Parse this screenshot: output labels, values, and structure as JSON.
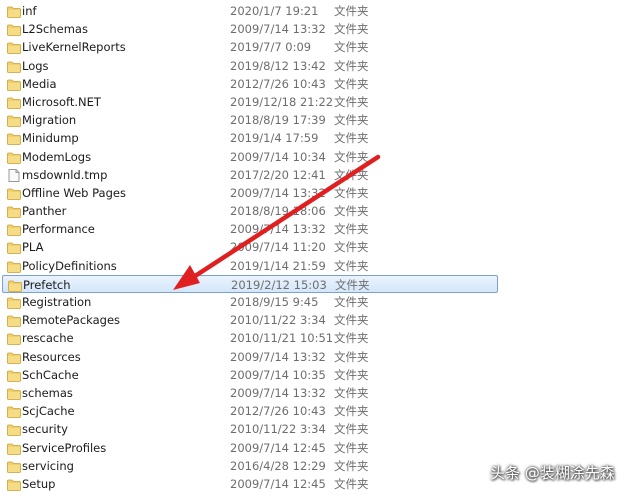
{
  "icons": {
    "folder": "folder-icon",
    "file": "file-icon"
  },
  "colors": {
    "folder": "#f3cf6b",
    "selection": "#cde3f9",
    "selection_border": "#7da2ce",
    "arrow": "#e02020"
  },
  "rows": [
    {
      "name": "inf",
      "date": "2020/1/7 19:21",
      "type": "文件夹",
      "kind": "folder"
    },
    {
      "name": "L2Schemas",
      "date": "2009/7/14 13:32",
      "type": "文件夹",
      "kind": "folder"
    },
    {
      "name": "LiveKernelReports",
      "date": "2019/7/7 0:09",
      "type": "文件夹",
      "kind": "folder"
    },
    {
      "name": "Logs",
      "date": "2019/8/12 13:42",
      "type": "文件夹",
      "kind": "folder"
    },
    {
      "name": "Media",
      "date": "2012/7/26 10:43",
      "type": "文件夹",
      "kind": "folder"
    },
    {
      "name": "Microsoft.NET",
      "date": "2019/12/18 21:22",
      "type": "文件夹",
      "kind": "folder"
    },
    {
      "name": "Migration",
      "date": "2018/8/19 17:39",
      "type": "文件夹",
      "kind": "folder"
    },
    {
      "name": "Minidump",
      "date": "2019/1/4 17:59",
      "type": "文件夹",
      "kind": "folder"
    },
    {
      "name": "ModemLogs",
      "date": "2009/7/14 10:34",
      "type": "文件夹",
      "kind": "folder"
    },
    {
      "name": "msdownld.tmp",
      "date": "2017/2/20 12:41",
      "type": "文件夹",
      "kind": "file"
    },
    {
      "name": "Offline Web Pages",
      "date": "2009/7/14 13:32",
      "type": "文件夹",
      "kind": "folder"
    },
    {
      "name": "Panther",
      "date": "2018/8/19 18:06",
      "type": "文件夹",
      "kind": "folder"
    },
    {
      "name": "Performance",
      "date": "2009/7/14 13:32",
      "type": "文件夹",
      "kind": "folder"
    },
    {
      "name": "PLA",
      "date": "2009/7/14 11:20",
      "type": "文件夹",
      "kind": "folder"
    },
    {
      "name": "PolicyDefinitions",
      "date": "2019/1/14 21:59",
      "type": "文件夹",
      "kind": "folder"
    },
    {
      "name": "Prefetch",
      "date": "2019/2/12 15:03",
      "type": "文件夹",
      "kind": "folder",
      "selected": true
    },
    {
      "name": "Registration",
      "date": "2018/9/15 9:45",
      "type": "文件夹",
      "kind": "folder"
    },
    {
      "name": "RemotePackages",
      "date": "2010/11/22 3:34",
      "type": "文件夹",
      "kind": "folder"
    },
    {
      "name": "rescache",
      "date": "2010/11/21 10:51",
      "type": "文件夹",
      "kind": "folder"
    },
    {
      "name": "Resources",
      "date": "2009/7/14 13:32",
      "type": "文件夹",
      "kind": "folder"
    },
    {
      "name": "SchCache",
      "date": "2009/7/14 10:35",
      "type": "文件夹",
      "kind": "folder"
    },
    {
      "name": "schemas",
      "date": "2009/7/14 13:32",
      "type": "文件夹",
      "kind": "folder"
    },
    {
      "name": "ScjCache",
      "date": "2012/7/26 10:43",
      "type": "文件夹",
      "kind": "folder"
    },
    {
      "name": "security",
      "date": "2010/11/22 3:34",
      "type": "文件夹",
      "kind": "folder"
    },
    {
      "name": "ServiceProfiles",
      "date": "2009/7/14 12:45",
      "type": "文件夹",
      "kind": "folder"
    },
    {
      "name": "servicing",
      "date": "2016/4/28 12:29",
      "type": "文件夹",
      "kind": "folder"
    },
    {
      "name": "Setup",
      "date": "2009/7/14 12:45",
      "type": "文件夹",
      "kind": "folder"
    }
  ],
  "watermark": "头条 @装糊涂先森"
}
